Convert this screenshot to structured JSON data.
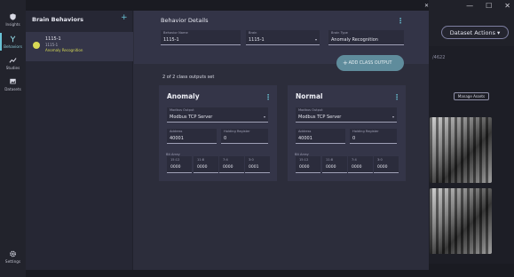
{
  "window": {
    "minimize": "—",
    "maximize": "☐",
    "close": "✕"
  },
  "background": {
    "dataset_actions": "Dataset Actions ▾",
    "faded_text": "/4622",
    "manage_assets": "Manage Assets"
  },
  "nav": [
    {
      "label": "Insights",
      "icon": "shield-icon"
    },
    {
      "label": "Behaviors",
      "icon": "tree-icon"
    },
    {
      "label": "Studies",
      "icon": "trend-icon"
    },
    {
      "label": "Datasets",
      "icon": "images-icon"
    },
    {
      "label": "Settings",
      "icon": "gear-icon"
    }
  ],
  "dialog": {
    "close": "✕",
    "list": {
      "title": "Brain Behaviors",
      "add": "+",
      "items": [
        {
          "name": "1115-1",
          "id": "1115-1",
          "type": "Anomaly Recognition"
        }
      ]
    },
    "details": {
      "title": "Behavior Details",
      "fields": {
        "behavior_name": {
          "label": "Behavior Name",
          "value": "1115-1"
        },
        "brain": {
          "label": "Brain",
          "value": "1115-1"
        },
        "brain_type": {
          "label": "Brain Type",
          "value": "Anomaly Recognition"
        }
      },
      "add_class_label": "ADD CLASS OUTPUT",
      "outputs_count": "2 of 2 class outputs set"
    },
    "classes": [
      {
        "name": "Anomaly",
        "modbus_label": "Modbus Output",
        "modbus_value": "Modbus TCP Server",
        "address_label": "Address",
        "address_value": "40001",
        "holding_label": "Holding Register",
        "holding_value": "0",
        "bit_array_label": "Bit Array",
        "registers": [
          {
            "label": "15:12",
            "value": "0000"
          },
          {
            "label": "11:8",
            "value": "0000"
          },
          {
            "label": "7:4",
            "value": "0000"
          },
          {
            "label": "3:0",
            "value": "0001"
          }
        ]
      },
      {
        "name": "Normal",
        "modbus_label": "Modbus Output",
        "modbus_value": "Modbus TCP Server",
        "address_label": "Address",
        "address_value": "40001",
        "holding_label": "Holding Register",
        "holding_value": "0",
        "bit_array_label": "Bit Array",
        "registers": [
          {
            "label": "15:12",
            "value": "0000"
          },
          {
            "label": "11:8",
            "value": "0000"
          },
          {
            "label": "7:4",
            "value": "0000"
          },
          {
            "label": "3:0",
            "value": "0000"
          }
        ]
      }
    ]
  }
}
